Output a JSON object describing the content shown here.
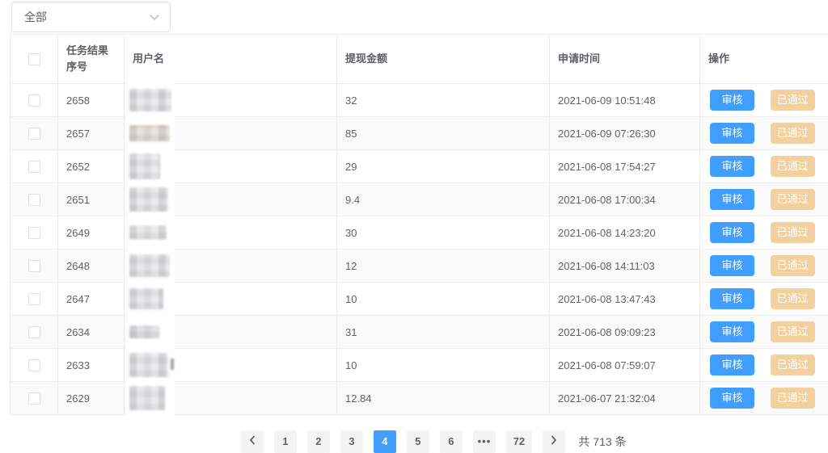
{
  "filter": {
    "selected_option": "全部",
    "chevron_icon": "chevron-down"
  },
  "table": {
    "headers": {
      "task_no": "任务结果序号",
      "username": "用户名",
      "amount": "提现金额",
      "apply_time": "申请时间",
      "action": "操作"
    },
    "rows": [
      {
        "task_no": "2658",
        "username_censored": true,
        "amount": "32",
        "apply_time": "2021-06-09 10:51:48"
      },
      {
        "task_no": "2657",
        "username_censored": true,
        "amount": "85",
        "apply_time": "2021-06-09 07:26:30"
      },
      {
        "task_no": "2652",
        "username_censored": true,
        "amount": "29",
        "apply_time": "2021-06-08 17:54:27"
      },
      {
        "task_no": "2651",
        "username_censored": true,
        "amount": "9.4",
        "apply_time": "2021-06-08 17:00:34"
      },
      {
        "task_no": "2649",
        "username_censored": true,
        "amount": "30",
        "apply_time": "2021-06-08 14:23:20"
      },
      {
        "task_no": "2648",
        "username_censored": true,
        "amount": "12",
        "apply_time": "2021-06-08 14:11:03"
      },
      {
        "task_no": "2647",
        "username_censored": true,
        "amount": "10",
        "apply_time": "2021-06-08 13:47:43"
      },
      {
        "task_no": "2634",
        "username_censored": true,
        "amount": "31",
        "apply_time": "2021-06-08 09:09:23"
      },
      {
        "task_no": "2633",
        "username_censored": true,
        "amount": "10",
        "apply_time": "2021-06-08 07:59:07"
      },
      {
        "task_no": "2629",
        "username_censored": true,
        "amount": "12.84",
        "apply_time": "2021-06-07 21:32:04"
      }
    ],
    "action_buttons": {
      "review": "审核",
      "approved": "已通过"
    }
  },
  "pagination": {
    "prev_icon": "chevron-left",
    "next_icon": "chevron-right",
    "pages": [
      "1",
      "2",
      "3",
      "4",
      "5",
      "6",
      "•••",
      "72"
    ],
    "active_page": "4",
    "total_text": "共 713 条"
  },
  "colors": {
    "primary": "#409eff",
    "approved_button_bg": "#f3d19e",
    "pager_button_bg": "#f4f4f5",
    "row_stripe": "#fafafa",
    "border": "#e9ebef",
    "text": "#606266"
  }
}
